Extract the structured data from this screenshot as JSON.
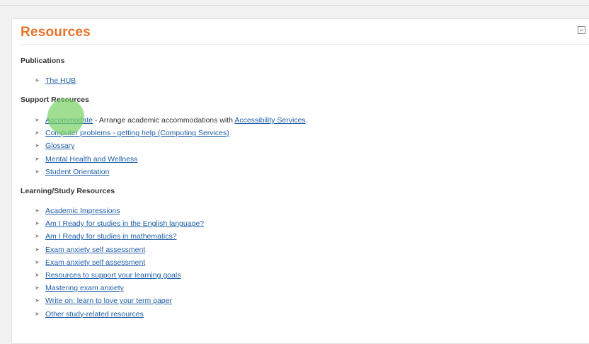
{
  "block": {
    "title": "Resources",
    "collapse_icon": "minus-square-icon"
  },
  "sections": {
    "publications": {
      "heading": "Publications",
      "items": [
        {
          "label": "The HUB"
        }
      ]
    },
    "support": {
      "heading": "Support Resources",
      "items": [
        {
          "label": "Accommodate",
          "suffix": " - Arrange academic accommodations with ",
          "link2": "Accessibility Services",
          "end": "."
        },
        {
          "label": "Computer problems - getting help (Computing Services)"
        },
        {
          "label": "Glossary"
        },
        {
          "label": "Mental Health and Wellness"
        },
        {
          "label": "Student Orientation"
        }
      ]
    },
    "learning": {
      "heading": "Learning/Study Resources",
      "items": [
        {
          "label": "Academic Impressions"
        },
        {
          "label": "Am I Ready for studies in the English language?"
        },
        {
          "label": "Am I Ready for studies in mathematics?"
        },
        {
          "label": "Exam anxiety self assessment"
        },
        {
          "label": "Exam anxiety self assessment"
        },
        {
          "label": "Resources to support your learning goals"
        },
        {
          "label": "Mastering exam anxiety"
        },
        {
          "label": "Write on: learn to love your term paper"
        },
        {
          "label": "Other study-related resources"
        }
      ]
    }
  },
  "bullet_icon": "chevron-right-icon",
  "colors": {
    "title": "#e8722b",
    "link": "#1f5ea8",
    "cursor_highlight": "#78d264"
  }
}
